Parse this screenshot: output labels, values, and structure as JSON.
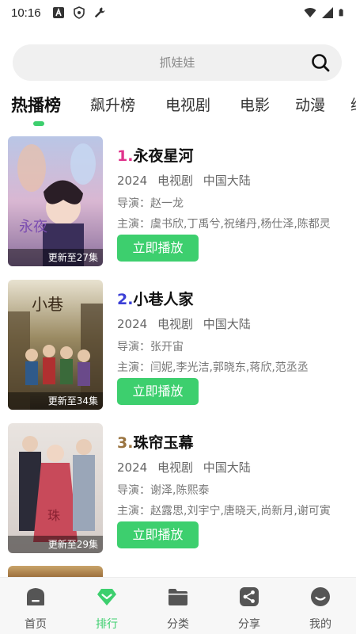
{
  "status_bar": {
    "time": "10:16"
  },
  "search": {
    "placeholder": "抓娃娃"
  },
  "tabs": [
    {
      "label": "热播榜",
      "active": true
    },
    {
      "label": "飙升榜",
      "active": false
    },
    {
      "label": "电视剧",
      "active": false
    },
    {
      "label": "电影",
      "active": false
    },
    {
      "label": "动漫",
      "active": false
    },
    {
      "label": "综",
      "active": false
    }
  ],
  "items": [
    {
      "rank": "1.",
      "rank_color": "#e0338c",
      "title": "永夜星河",
      "year": "2024",
      "type": "电视剧",
      "region": "中国大陆",
      "director": "导演：赵一龙",
      "cast": "主演：虞书欣,丁禹兮,祝绪丹,杨仕泽,陈都灵",
      "badge": "更新至27集",
      "play_label": "立即播放"
    },
    {
      "rank": "2.",
      "rank_color": "#3b3fd6",
      "title": "小巷人家",
      "year": "2024",
      "type": "电视剧",
      "region": "中国大陆",
      "director": "导演：张开宙",
      "cast": "主演：闫妮,李光洁,郭晓东,蒋欣,范丞丞",
      "badge": "更新至34集",
      "play_label": "立即播放"
    },
    {
      "rank": "3.",
      "rank_color": "#9a7440",
      "title": "珠帘玉幕",
      "year": "2024",
      "type": "电视剧",
      "region": "中国大陆",
      "director": "导演：谢泽,陈熙泰",
      "cast": "主演：赵露思,刘宇宁,唐晓天,尚新月,谢可寅",
      "badge": "更新至29集",
      "play_label": "立即播放"
    }
  ],
  "bottom_nav": [
    {
      "label": "首页",
      "icon": "home-icon",
      "active": false
    },
    {
      "label": "排行",
      "icon": "diamond-icon",
      "active": true
    },
    {
      "label": "分类",
      "icon": "folder-icon",
      "active": false
    },
    {
      "label": "分享",
      "icon": "share-icon",
      "active": false
    },
    {
      "label": "我的",
      "icon": "profile-icon",
      "active": false
    }
  ],
  "colors": {
    "accent": "#3dcf6e",
    "nav_inactive": "#555555"
  }
}
